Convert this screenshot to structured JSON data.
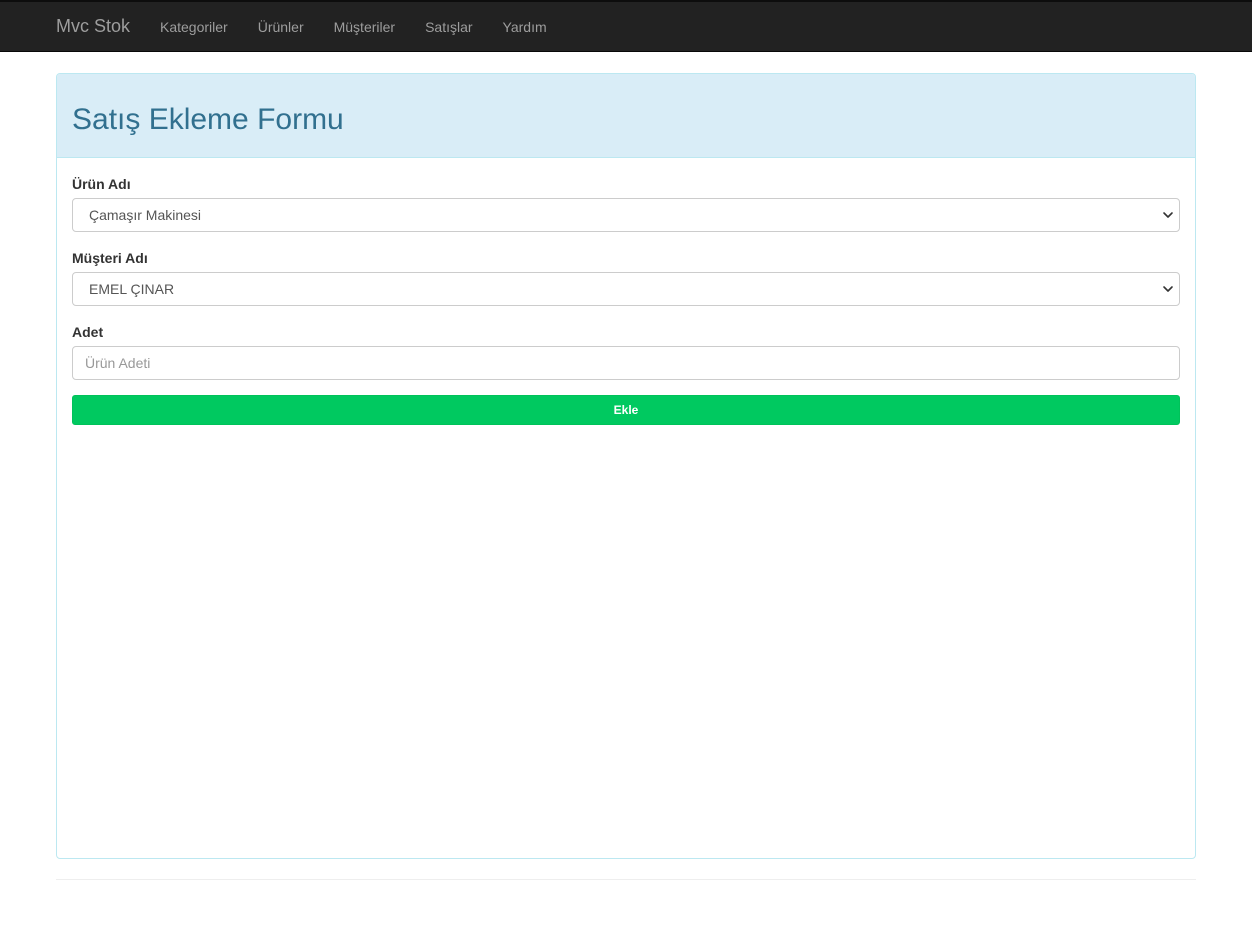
{
  "navbar": {
    "brand": "Mvc Stok",
    "links": [
      "Kategoriler",
      "Ürünler",
      "Müşteriler",
      "Satışlar",
      "Yardım"
    ]
  },
  "form": {
    "title": "Satış Ekleme Formu",
    "product": {
      "label": "Ürün Adı",
      "selected": "Çamaşır Makinesi"
    },
    "customer": {
      "label": "Müşteri Adı",
      "selected": "EMEL ÇINAR"
    },
    "quantity": {
      "label": "Adet",
      "value": "",
      "placeholder": "Ürün Adeti"
    },
    "submit_label": "Ekle"
  },
  "colors": {
    "navbar_bg": "#222222",
    "panel_heading_bg": "#d9edf7",
    "panel_title": "#31708f",
    "submit_bg": "#00c960"
  },
  "icons": {
    "select_arrow": "chevron-down-icon"
  }
}
